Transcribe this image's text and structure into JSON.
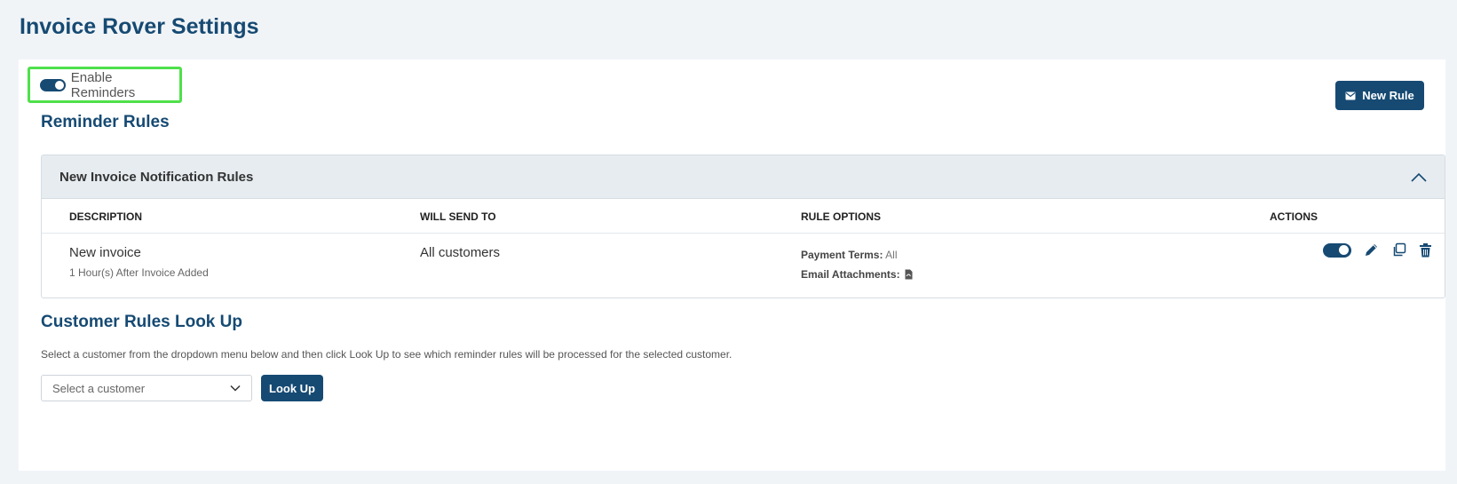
{
  "page": {
    "title": "Invoice Rover Settings"
  },
  "enable_reminders": {
    "label": "Enable Reminders",
    "enabled": true
  },
  "toolbar": {
    "new_rule_label": "New Rule"
  },
  "reminder_rules": {
    "title": "Reminder Rules",
    "panel": {
      "title": "New Invoice Notification Rules",
      "expanded": true,
      "columns": [
        "DESCRIPTION",
        "WILL SEND TO",
        "RULE OPTIONS",
        "ACTIONS"
      ],
      "rows": [
        {
          "description": "New invoice",
          "timing": "1 Hour(s) After Invoice Added",
          "send_to": "All customers",
          "payment_terms_label": "Payment Terms:",
          "payment_terms_value": "All",
          "attachments_label": "Email Attachments:",
          "attachment_icon": "pdf-file-icon",
          "enabled": true
        }
      ]
    }
  },
  "lookup": {
    "title": "Customer Rules Look Up",
    "description": "Select a customer from the dropdown menu below and then click Look Up to see which reminder rules will be processed for the selected customer.",
    "select_placeholder": "Select a customer",
    "button_label": "Look Up"
  },
  "colors": {
    "primary": "#164a73",
    "highlight": "#4fe04b",
    "panel_header": "#e6ecf0"
  },
  "icons": [
    "envelope-icon",
    "chevron-up-icon",
    "pencil-icon",
    "copy-icon",
    "trash-icon",
    "chevron-down-icon",
    "pdf-file-icon"
  ]
}
